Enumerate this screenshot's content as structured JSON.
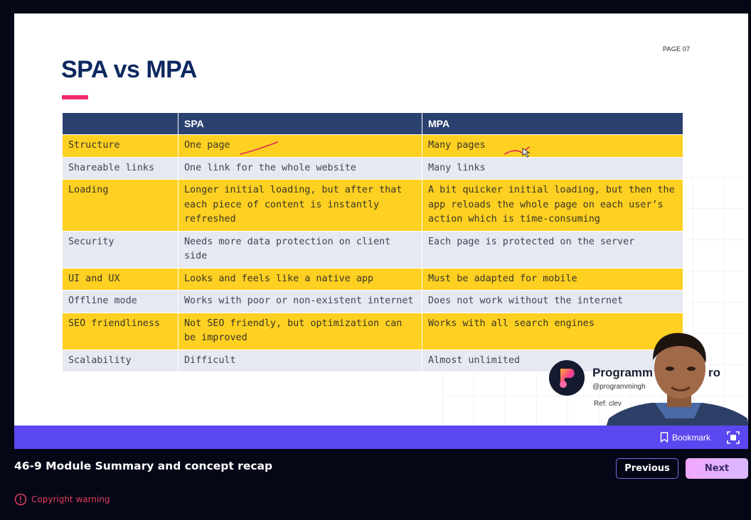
{
  "slide": {
    "page_number": "PAGE 07",
    "title": "SPA vs MPA",
    "table": {
      "headers": [
        "",
        "SPA",
        "MPA"
      ],
      "rows": [
        [
          "Structure",
          "One page",
          "Many pages"
        ],
        [
          "Shareable links",
          "One link for the whole website",
          "Many links"
        ],
        [
          "Loading",
          "Longer initial loading, but after that each piece of content is instantly refreshed",
          "A bit quicker initial loading, but then the app reloads the whole page on each user’s action which is time-consuming"
        ],
        [
          "Security",
          "Needs more data protection on client side",
          "Each page is protected on the server"
        ],
        [
          "UI and UX",
          "Looks and feels like a native app",
          "Must be adapted for mobile"
        ],
        [
          "Offline mode",
          "Works with poor or non-existent internet",
          "Does not work without the internet"
        ],
        [
          "SEO friendliness",
          "Not SEO friendly, but optimization can be improved",
          "Works with all search engines"
        ],
        [
          "Scalability",
          "Difficult",
          "Almost unlimited"
        ]
      ]
    },
    "brand": {
      "name": "Programm",
      "name_tail": "ro",
      "handle": "@programmingh",
      "ref": "Ref: clev"
    }
  },
  "player": {
    "bookmark_label": "Bookmark"
  },
  "lesson": {
    "title": "46-9 Module Summary and concept recap"
  },
  "nav": {
    "previous_label": "Previous",
    "next_label": "Next"
  },
  "footer": {
    "copyright_label": "Copyright warning"
  },
  "colors": {
    "header_bg": "#2b4170",
    "row_yellow": "#fdd021",
    "row_grey": "#e6e8f2",
    "accent": "#ef2a6b",
    "player_bar": "#5b47ef",
    "warning": "#e23d5e"
  }
}
